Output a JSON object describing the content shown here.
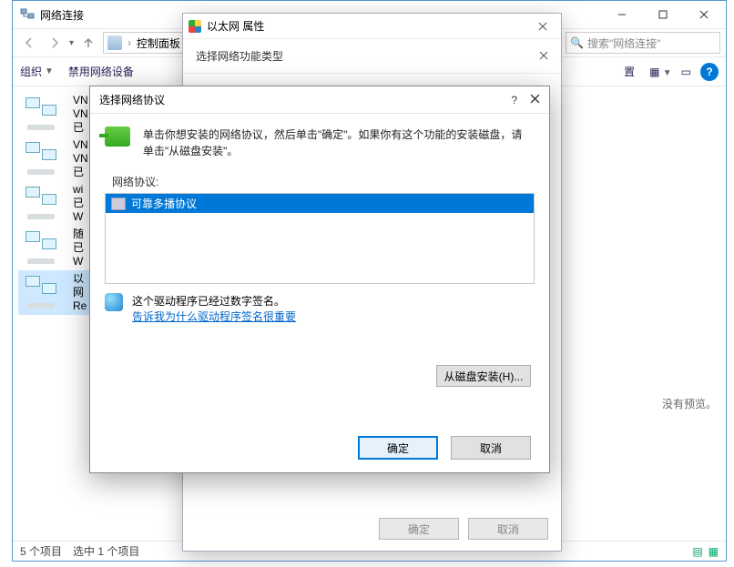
{
  "main_window": {
    "title": "网络连接",
    "breadcrumb": "控制面板",
    "search_placeholder": "搜索\"网络连接\"",
    "toolbar": {
      "organize": "组织",
      "disable": "禁用网络设备",
      "diagnose": "置"
    },
    "connections": [
      {
        "name": "VN",
        "line2": "VN",
        "line3": "已"
      },
      {
        "name": "VN",
        "line2": "VN",
        "line3": "已"
      },
      {
        "name": "wi",
        "line2": "已",
        "line3": "W"
      },
      {
        "name": "随",
        "line2": "已",
        "line3": "W"
      },
      {
        "name": "以",
        "line2": "网",
        "line3": "Re"
      }
    ],
    "preview_text": "没有预览。",
    "status": {
      "count": "5 个项目",
      "selected": "选中 1 个项目"
    }
  },
  "eth_dialog": {
    "title": "以太网 属性",
    "subtitle": "选择网络功能类型",
    "ok": "确定",
    "cancel": "取消"
  },
  "prot_dialog": {
    "title": "选择网络协议",
    "help": "?",
    "instruction": "单击你想安装的网络协议，然后单击\"确定\"。如果你有这个功能的安装磁盘，请单击\"从磁盘安装\"。",
    "group_label": "网络协议:",
    "protocol": "可靠多播协议",
    "signed_text": "这个驱动程序已经过数字签名。",
    "why_link": "告诉我为什么驱动程序签名很重要",
    "install_disk": "从磁盘安装(H)...",
    "ok": "确定",
    "cancel": "取消"
  }
}
